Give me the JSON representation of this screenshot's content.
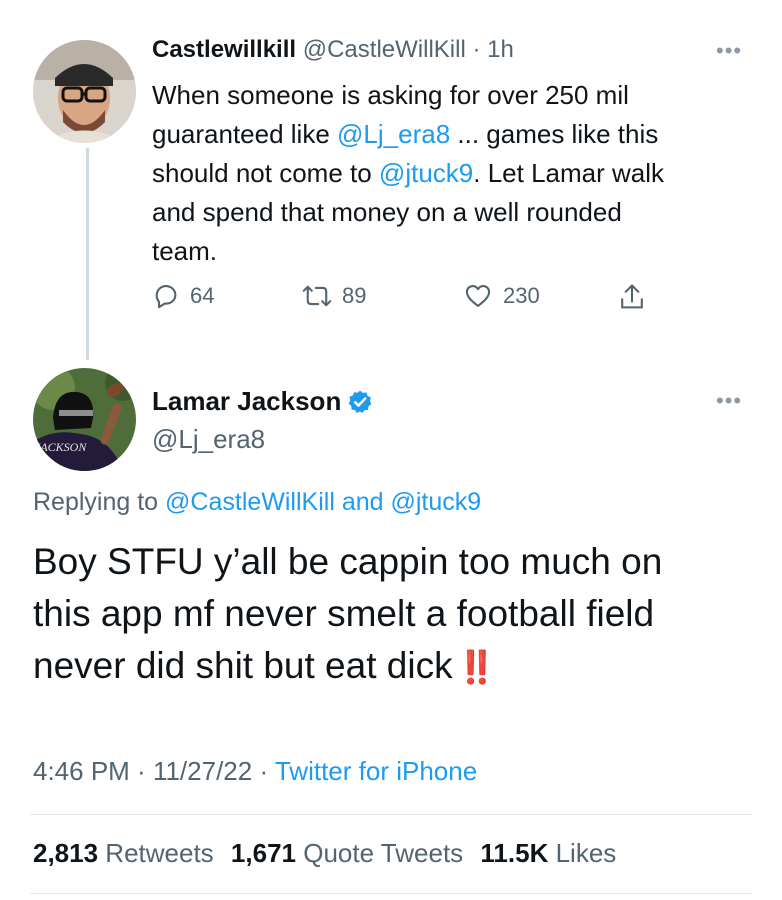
{
  "quoted": {
    "display_name": "Castlewillkill",
    "handle": "@CastleWillKill",
    "separator": "·",
    "time": "1h",
    "text_lines": [
      [
        {
          "t": "When someone is asking for over 250 mil",
          "link": false
        }
      ],
      [
        {
          "t": "guaranteed like ",
          "link": false
        },
        {
          "t": "@Lj_era8",
          "link": true
        },
        {
          "t": " ... games like this",
          "link": false
        }
      ],
      [
        {
          "t": "should not come to ",
          "link": false
        },
        {
          "t": "@jtuck9",
          "link": true
        },
        {
          "t": ". Let Lamar walk",
          "link": false
        }
      ],
      [
        {
          "t": "and spend that money on a well rounded",
          "link": false
        }
      ],
      [
        {
          "t": "team.",
          "link": false
        }
      ]
    ],
    "actions": {
      "reply_count": "64",
      "retweet_count": "89",
      "like_count": "230"
    },
    "more_icon": "more-horizontal-icon"
  },
  "main": {
    "display_name": "Lamar Jackson",
    "handle": "@Lj_era8",
    "verified": true,
    "replying_prefix": "Replying to ",
    "replying_user1": "@CastleWillKill",
    "replying_and": " and ",
    "replying_user2": "@jtuck9",
    "text_lines": [
      "Boy STFU y’all be cappin too much on",
      "this app mf never smelt a football field",
      "never did shit but eat dick"
    ],
    "emoji": "‼️",
    "time": "4:46 PM",
    "sep1": " · ",
    "date": "11/27/22",
    "sep2": " · ",
    "source": "Twitter for iPhone",
    "avatar_jersey_text": "JACKSON",
    "more_icon": "more-horizontal-icon"
  },
  "stats": {
    "retweets_num": "2,813",
    "retweets_label": " Retweets",
    "quotes_num": "1,671",
    "quotes_label": " Quote Tweets",
    "likes_num": "11.5K",
    "likes_label": " Likes"
  },
  "colors": {
    "link": "#1d9bf0",
    "muted": "#536471",
    "text": "#0f1419",
    "verified": "#1d9bf0",
    "emoji_red": "#e0241b"
  }
}
